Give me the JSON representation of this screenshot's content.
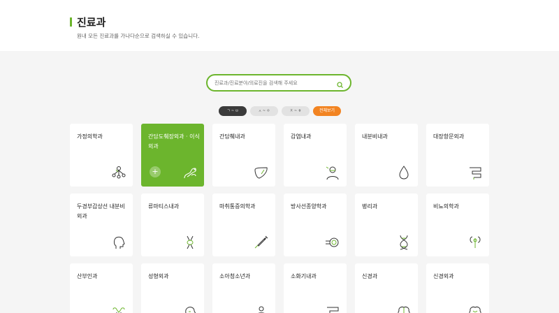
{
  "header": {
    "title": "진료과",
    "description": "원내 모든 진료과를 가나다순으로 검색하실 수 있습니다."
  },
  "search": {
    "placeholder": "진료과/진료분야/의료진을 검색해 주세요"
  },
  "filters": [
    {
      "label": "ㄱ ~ ㅂ",
      "active": true
    },
    {
      "label": "ㅅ ~ ㅇ",
      "active": false
    },
    {
      "label": "ㅈ ~ ㅎ",
      "active": false
    },
    {
      "label": "전체보기",
      "active": false
    }
  ],
  "colors": {
    "accent": "#6cb52d",
    "orange": "#f28422",
    "dark": "#3b3b3b"
  },
  "departments": [
    {
      "label": "가정의학과",
      "icon": "family-icon"
    },
    {
      "label": "간담도췌장외과 · 이식외과",
      "icon": "liver-pancreas-icon",
      "active": true
    },
    {
      "label": "간담췌내과",
      "icon": "liver-icon"
    },
    {
      "label": "감염내과",
      "icon": "doctor-mask-icon"
    },
    {
      "label": "내분비내과",
      "icon": "drop-icon"
    },
    {
      "label": "대장항문외과",
      "icon": "intestine-icon"
    },
    {
      "label": "두경부갑상선 내분비외과",
      "icon": "head-icon"
    },
    {
      "label": "류마티스내과",
      "icon": "joint-icon"
    },
    {
      "label": "마취통증의학과",
      "icon": "syringe-icon"
    },
    {
      "label": "방사선종양학과",
      "icon": "radiation-icon"
    },
    {
      "label": "병리과",
      "icon": "dna-icon"
    },
    {
      "label": "비뇨의학과",
      "icon": "kidney-icon"
    },
    {
      "label": "산부인과",
      "icon": "uterus-icon"
    },
    {
      "label": "성형외과",
      "icon": "face-icon"
    },
    {
      "label": "소아청소년과",
      "icon": "child-icon"
    },
    {
      "label": "소화기내과",
      "icon": "stomach-icon"
    },
    {
      "label": "신경과",
      "icon": "brain-icon"
    },
    {
      "label": "신경외과",
      "icon": "brain-surgery-icon"
    }
  ]
}
